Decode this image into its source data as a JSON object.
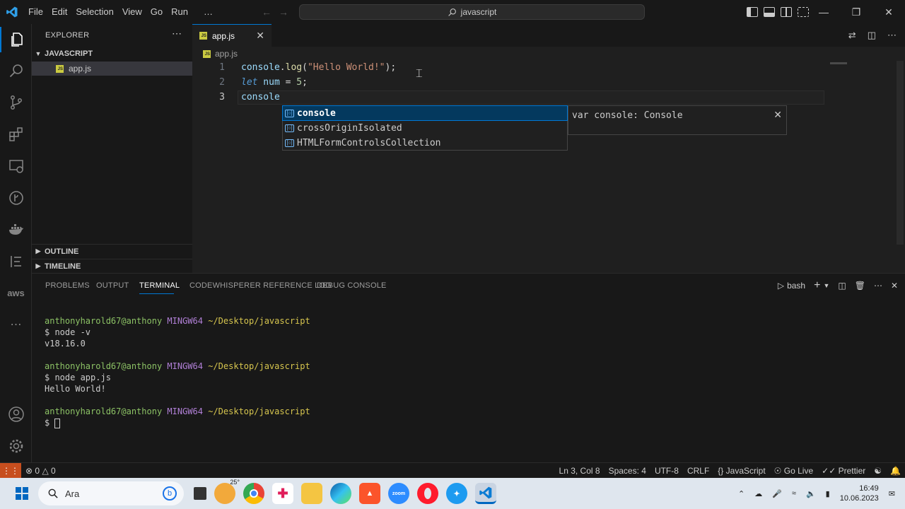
{
  "menu": [
    "File",
    "Edit",
    "Selection",
    "View",
    "Go",
    "Run",
    "…"
  ],
  "command_center": {
    "text": "javascript"
  },
  "explorer": {
    "header": "EXPLORER",
    "folder": "JAVASCRIPT",
    "file": "app.js",
    "outline": "OUTLINE",
    "timeline": "TIMELINE"
  },
  "tab": {
    "label": "app.js",
    "breadcrumb": "app.js"
  },
  "code": {
    "line_numbers": [
      "1",
      "2",
      "3"
    ],
    "l1": {
      "obj": "console",
      "dot": ".",
      "fn": "log",
      "open": "(",
      "str": "\"Hello World!\"",
      "close": ");"
    },
    "l2": {
      "kw": "let",
      "name": " num ",
      "op": "=",
      "num": " 5",
      "semi": ";"
    },
    "l3": {
      "text": "console"
    }
  },
  "suggest": {
    "items": [
      "console",
      "crossOriginIsolated",
      "HTMLFormControlsCollection"
    ],
    "selected_index": 0,
    "detail": "var console: Console",
    "icon": "[○]"
  },
  "panel": {
    "tabs": [
      "PROBLEMS",
      "OUTPUT",
      "TERMINAL",
      "CODEWHISPERER REFERENCE LOG",
      "DEBUG CONSOLE"
    ],
    "active_tab": "TERMINAL",
    "shell": "bash"
  },
  "terminal": {
    "prompt_user": "anthonyharold67@anthony",
    "prompt_host": "MINGW64",
    "prompt_path": "~/Desktop/javascript",
    "cmd1": "$ node -v",
    "out1": "v18.16.0",
    "cmd2": "$ node app.js",
    "out2": "Hello World!",
    "cmd3": "$ "
  },
  "status": {
    "errors": "0",
    "warnings": "0",
    "position": "Ln 3, Col 8",
    "spaces": "Spaces: 4",
    "encoding": "UTF-8",
    "eol": "CRLF",
    "language": "JavaScript",
    "golive": "Go Live",
    "prettier": "Prettier"
  },
  "taskbar": {
    "search_placeholder": "Ara",
    "weather": "25°",
    "time": "16:49",
    "date": "10.06.2023"
  },
  "activity": {
    "aws_label": "aws"
  },
  "colors": {
    "accent": "#0078d4",
    "remote": "#c74e1e",
    "js_badge": "#cbcb41"
  }
}
